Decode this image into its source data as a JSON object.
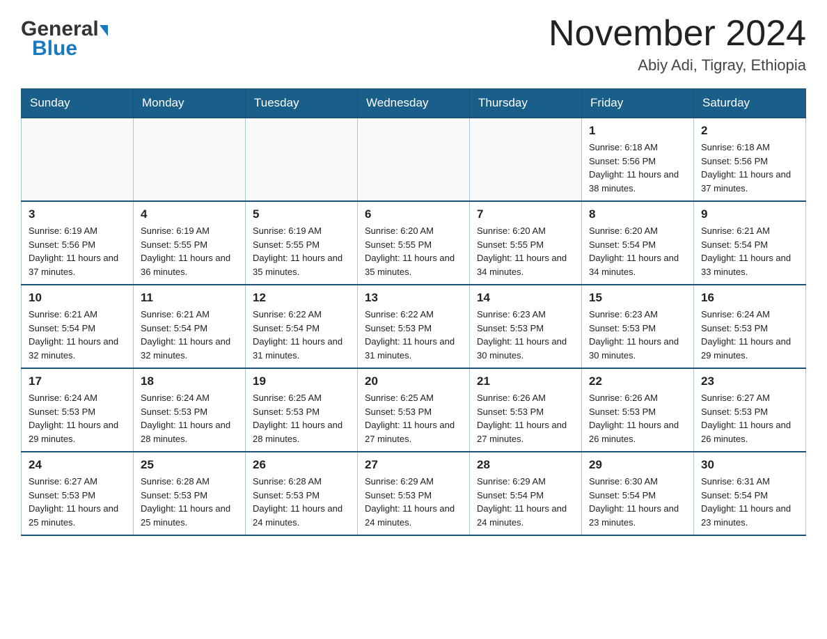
{
  "header": {
    "logo_general": "General",
    "logo_blue": "Blue",
    "title": "November 2024",
    "subtitle": "Abiy Adi, Tigray, Ethiopia"
  },
  "days_of_week": [
    "Sunday",
    "Monday",
    "Tuesday",
    "Wednesday",
    "Thursday",
    "Friday",
    "Saturday"
  ],
  "weeks": [
    [
      {
        "day": "",
        "sunrise": "",
        "sunset": "",
        "daylight": ""
      },
      {
        "day": "",
        "sunrise": "",
        "sunset": "",
        "daylight": ""
      },
      {
        "day": "",
        "sunrise": "",
        "sunset": "",
        "daylight": ""
      },
      {
        "day": "",
        "sunrise": "",
        "sunset": "",
        "daylight": ""
      },
      {
        "day": "",
        "sunrise": "",
        "sunset": "",
        "daylight": ""
      },
      {
        "day": "1",
        "sunrise": "Sunrise: 6:18 AM",
        "sunset": "Sunset: 5:56 PM",
        "daylight": "Daylight: 11 hours and 38 minutes."
      },
      {
        "day": "2",
        "sunrise": "Sunrise: 6:18 AM",
        "sunset": "Sunset: 5:56 PM",
        "daylight": "Daylight: 11 hours and 37 minutes."
      }
    ],
    [
      {
        "day": "3",
        "sunrise": "Sunrise: 6:19 AM",
        "sunset": "Sunset: 5:56 PM",
        "daylight": "Daylight: 11 hours and 37 minutes."
      },
      {
        "day": "4",
        "sunrise": "Sunrise: 6:19 AM",
        "sunset": "Sunset: 5:55 PM",
        "daylight": "Daylight: 11 hours and 36 minutes."
      },
      {
        "day": "5",
        "sunrise": "Sunrise: 6:19 AM",
        "sunset": "Sunset: 5:55 PM",
        "daylight": "Daylight: 11 hours and 35 minutes."
      },
      {
        "day": "6",
        "sunrise": "Sunrise: 6:20 AM",
        "sunset": "Sunset: 5:55 PM",
        "daylight": "Daylight: 11 hours and 35 minutes."
      },
      {
        "day": "7",
        "sunrise": "Sunrise: 6:20 AM",
        "sunset": "Sunset: 5:55 PM",
        "daylight": "Daylight: 11 hours and 34 minutes."
      },
      {
        "day": "8",
        "sunrise": "Sunrise: 6:20 AM",
        "sunset": "Sunset: 5:54 PM",
        "daylight": "Daylight: 11 hours and 34 minutes."
      },
      {
        "day": "9",
        "sunrise": "Sunrise: 6:21 AM",
        "sunset": "Sunset: 5:54 PM",
        "daylight": "Daylight: 11 hours and 33 minutes."
      }
    ],
    [
      {
        "day": "10",
        "sunrise": "Sunrise: 6:21 AM",
        "sunset": "Sunset: 5:54 PM",
        "daylight": "Daylight: 11 hours and 32 minutes."
      },
      {
        "day": "11",
        "sunrise": "Sunrise: 6:21 AM",
        "sunset": "Sunset: 5:54 PM",
        "daylight": "Daylight: 11 hours and 32 minutes."
      },
      {
        "day": "12",
        "sunrise": "Sunrise: 6:22 AM",
        "sunset": "Sunset: 5:54 PM",
        "daylight": "Daylight: 11 hours and 31 minutes."
      },
      {
        "day": "13",
        "sunrise": "Sunrise: 6:22 AM",
        "sunset": "Sunset: 5:53 PM",
        "daylight": "Daylight: 11 hours and 31 minutes."
      },
      {
        "day": "14",
        "sunrise": "Sunrise: 6:23 AM",
        "sunset": "Sunset: 5:53 PM",
        "daylight": "Daylight: 11 hours and 30 minutes."
      },
      {
        "day": "15",
        "sunrise": "Sunrise: 6:23 AM",
        "sunset": "Sunset: 5:53 PM",
        "daylight": "Daylight: 11 hours and 30 minutes."
      },
      {
        "day": "16",
        "sunrise": "Sunrise: 6:24 AM",
        "sunset": "Sunset: 5:53 PM",
        "daylight": "Daylight: 11 hours and 29 minutes."
      }
    ],
    [
      {
        "day": "17",
        "sunrise": "Sunrise: 6:24 AM",
        "sunset": "Sunset: 5:53 PM",
        "daylight": "Daylight: 11 hours and 29 minutes."
      },
      {
        "day": "18",
        "sunrise": "Sunrise: 6:24 AM",
        "sunset": "Sunset: 5:53 PM",
        "daylight": "Daylight: 11 hours and 28 minutes."
      },
      {
        "day": "19",
        "sunrise": "Sunrise: 6:25 AM",
        "sunset": "Sunset: 5:53 PM",
        "daylight": "Daylight: 11 hours and 28 minutes."
      },
      {
        "day": "20",
        "sunrise": "Sunrise: 6:25 AM",
        "sunset": "Sunset: 5:53 PM",
        "daylight": "Daylight: 11 hours and 27 minutes."
      },
      {
        "day": "21",
        "sunrise": "Sunrise: 6:26 AM",
        "sunset": "Sunset: 5:53 PM",
        "daylight": "Daylight: 11 hours and 27 minutes."
      },
      {
        "day": "22",
        "sunrise": "Sunrise: 6:26 AM",
        "sunset": "Sunset: 5:53 PM",
        "daylight": "Daylight: 11 hours and 26 minutes."
      },
      {
        "day": "23",
        "sunrise": "Sunrise: 6:27 AM",
        "sunset": "Sunset: 5:53 PM",
        "daylight": "Daylight: 11 hours and 26 minutes."
      }
    ],
    [
      {
        "day": "24",
        "sunrise": "Sunrise: 6:27 AM",
        "sunset": "Sunset: 5:53 PM",
        "daylight": "Daylight: 11 hours and 25 minutes."
      },
      {
        "day": "25",
        "sunrise": "Sunrise: 6:28 AM",
        "sunset": "Sunset: 5:53 PM",
        "daylight": "Daylight: 11 hours and 25 minutes."
      },
      {
        "day": "26",
        "sunrise": "Sunrise: 6:28 AM",
        "sunset": "Sunset: 5:53 PM",
        "daylight": "Daylight: 11 hours and 24 minutes."
      },
      {
        "day": "27",
        "sunrise": "Sunrise: 6:29 AM",
        "sunset": "Sunset: 5:53 PM",
        "daylight": "Daylight: 11 hours and 24 minutes."
      },
      {
        "day": "28",
        "sunrise": "Sunrise: 6:29 AM",
        "sunset": "Sunset: 5:54 PM",
        "daylight": "Daylight: 11 hours and 24 minutes."
      },
      {
        "day": "29",
        "sunrise": "Sunrise: 6:30 AM",
        "sunset": "Sunset: 5:54 PM",
        "daylight": "Daylight: 11 hours and 23 minutes."
      },
      {
        "day": "30",
        "sunrise": "Sunrise: 6:31 AM",
        "sunset": "Sunset: 5:54 PM",
        "daylight": "Daylight: 11 hours and 23 minutes."
      }
    ]
  ]
}
